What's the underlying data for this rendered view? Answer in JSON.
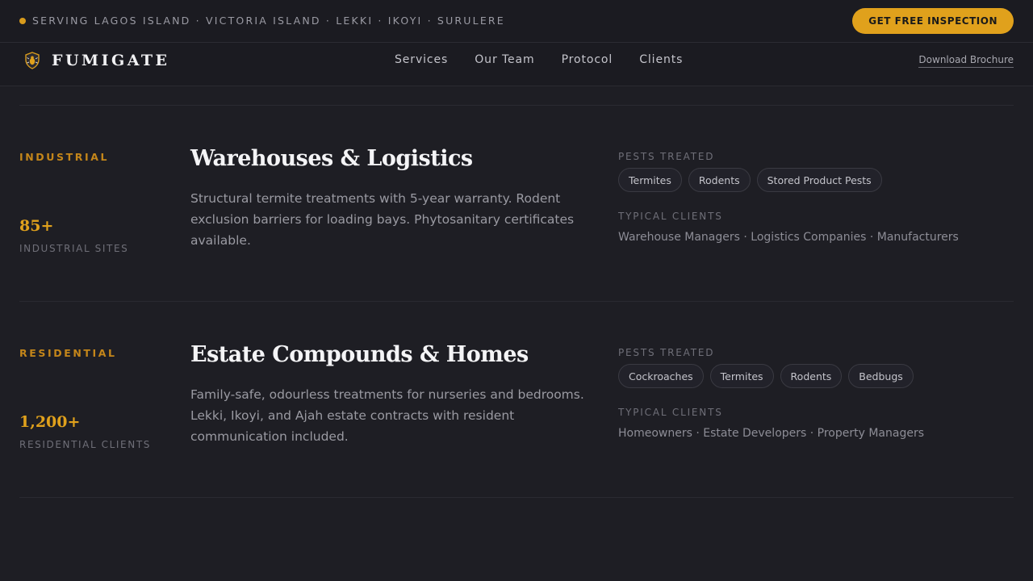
{
  "topbar": {
    "service_area": "SERVING LAGOS ISLAND · VICTORIA ISLAND · LEKKI · IKOYI · SURULERE",
    "cta_label": "GET FREE INSPECTION",
    "accent_color": "#e0a11c"
  },
  "nav": {
    "logo_text": "FUMIGATE",
    "logo_icon": "shield-bug-icon",
    "links": [
      "Services",
      "Our Team",
      "Protocol",
      "Clients"
    ],
    "brochure_label": "Download Brochure"
  },
  "sectors": [
    {
      "category": "INDUSTRIAL",
      "stat_value": "85+",
      "stat_label": "INDUSTRIAL SITES",
      "title": "Warehouses & Logistics",
      "description": "Structural termite treatments with 5-year warranty. Rodent exclusion barriers for loading bays. Phytosanitary certificates available.",
      "pests_label": "PESTS TREATED",
      "pests": [
        "Termites",
        "Rodents",
        "Stored Product Pests"
      ],
      "clients_label": "TYPICAL CLIENTS",
      "clients": "Warehouse Managers · Logistics Companies · Manufacturers"
    },
    {
      "category": "RESIDENTIAL",
      "stat_value": "1,200+",
      "stat_label": "RESIDENTIAL CLIENTS",
      "title": "Estate Compounds & Homes",
      "description": "Family-safe, odourless treatments for nurseries and bedrooms. Lekki, Ikoyi, and Ajah estate contracts with resident communication included.",
      "pests_label": "PESTS TREATED",
      "pests": [
        "Cockroaches",
        "Termites",
        "Rodents",
        "Bedbugs"
      ],
      "clients_label": "TYPICAL CLIENTS",
      "clients": "Homeowners · Estate Developers · Property Managers"
    }
  ]
}
